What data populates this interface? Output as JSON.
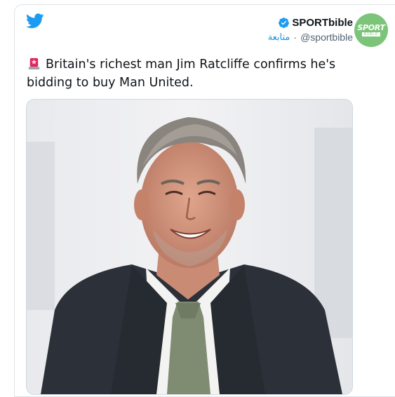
{
  "tweet": {
    "display_name": "SPORTbible",
    "handle": "@sportbible",
    "separator": "·",
    "follow_label": "متابعة",
    "text": "Britain's richest man Jim Ratcliffe confirms he's bidding to buy Man United.",
    "emoji_icon": "police-siren-icon",
    "media_description_icon": "tweet-photo"
  },
  "avatar": {
    "main_text": "SPORT",
    "sub_text": "BIBLE"
  },
  "icons": {
    "brand": "twitter-bird-icon",
    "verified": "verified-badge-icon"
  },
  "colors": {
    "twitter_blue": "#1d9bf0",
    "link_blue": "#1b95e0",
    "avatar_green": "#7cc47a",
    "text_dark": "#0f1419",
    "text_muted": "#536471"
  }
}
